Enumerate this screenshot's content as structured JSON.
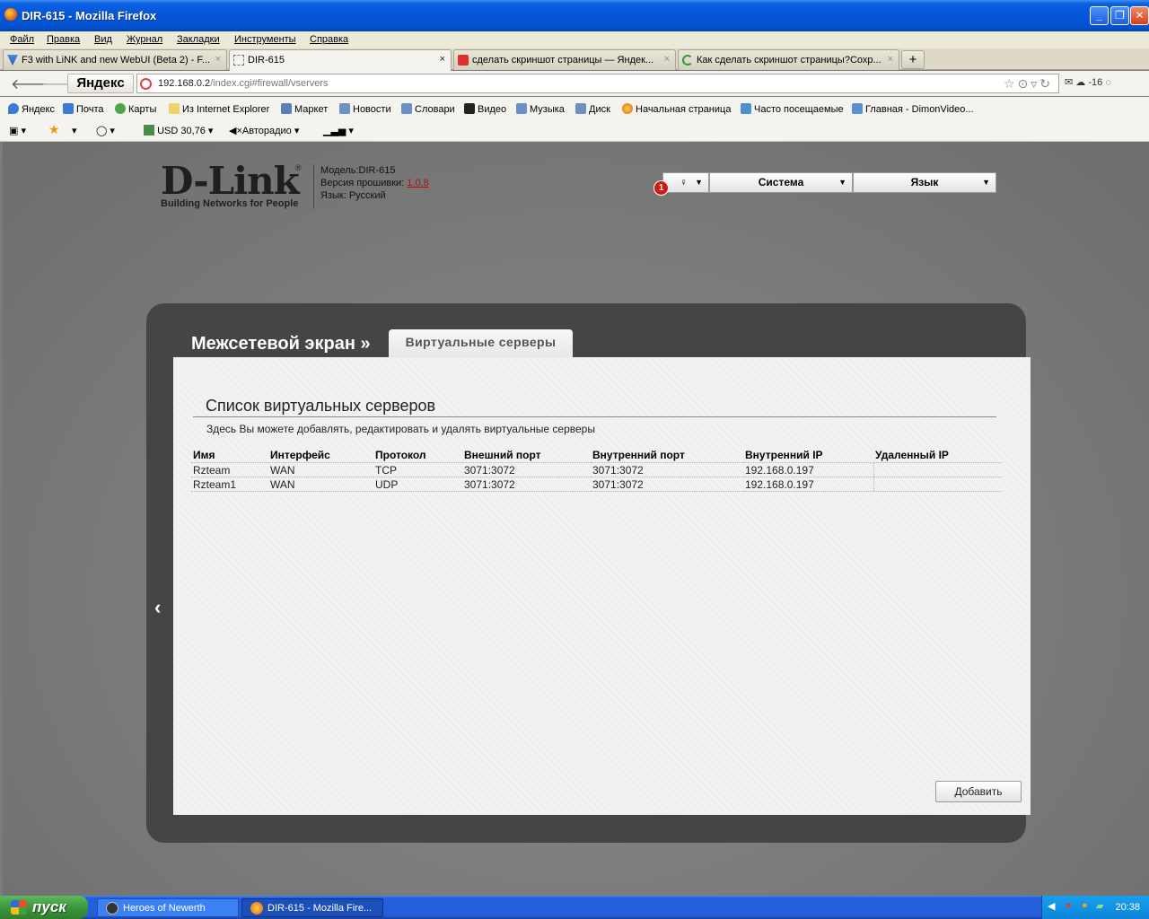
{
  "window": {
    "title": "DIR-615 - Mozilla Firefox"
  },
  "menu": [
    "Файл",
    "Правка",
    "Вид",
    "Журнал",
    "Закладки",
    "Инструменты",
    "Справка"
  ],
  "tabs": [
    {
      "label": "F3 with LiNK and new WebUI (Beta 2) - F...",
      "close": "×"
    },
    {
      "label": "DIR-615",
      "close": "×"
    },
    {
      "label": "сделать скриншот страницы — Яндек...",
      "close": "×"
    },
    {
      "label": "Как сделать скриншот страницы?Сохр...",
      "close": "×"
    }
  ],
  "new_tab": "+",
  "nav": {
    "yandex_button": "Яндекс",
    "url_host": "192.168.0.2",
    "url_path": "/index.cgi#firewall/vservers",
    "weather": "-16"
  },
  "bookmarks": [
    "Яндекс",
    "Почта",
    "Карты",
    "Из Internet Explorer",
    "Маркет",
    "Новости",
    "Словари",
    "Видео",
    "Музыка",
    "Диск",
    "Начальная страница",
    "Часто посещаемые",
    "Главная - DimonVideo..."
  ],
  "toolbar2": {
    "currency": "USD 30,76",
    "radio": "Авторадио"
  },
  "router": {
    "logo": "D-Link",
    "logo_reg": "®",
    "tagline": "Building Networks for People",
    "model": "Модель:DIR-615",
    "firmware_label": "Версия прошивки:",
    "firmware_version": "1.0.8",
    "language_line": "Язык: Русский",
    "notification_count": "1",
    "menu_system": "Система",
    "menu_language": "Язык",
    "breadcrumb": "Межсетевой экран »",
    "active_tab": "Виртуальные серверы",
    "section_title": "Список виртуальных серверов",
    "section_desc": "Здесь Вы можете добавлять, редактировать и удалять виртуальные серверы",
    "columns": [
      "Имя",
      "Интерфейс",
      "Протокол",
      "Внешний порт",
      "Внутренний порт",
      "Внутренний IP",
      "Удаленный IP"
    ],
    "rows": [
      [
        "Rzteam",
        "WAN",
        "TCP",
        "3071:3072",
        "3071:3072",
        "192.168.0.197",
        ""
      ],
      [
        "Rzteam1",
        "WAN",
        "UDP",
        "3071:3072",
        "3071:3072",
        "192.168.0.197",
        ""
      ]
    ],
    "add_button": "Добавить",
    "back_arrow": "‹"
  },
  "taskbar": {
    "start": "пуск",
    "tasks": [
      "Heroes of Newerth",
      "DIR-615 - Mozilla Fire..."
    ],
    "clock": "20:38"
  },
  "colors": {
    "titlebar": "#0457d8",
    "panel": "#454545",
    "content": "#efefef",
    "badge": "#d01818"
  }
}
